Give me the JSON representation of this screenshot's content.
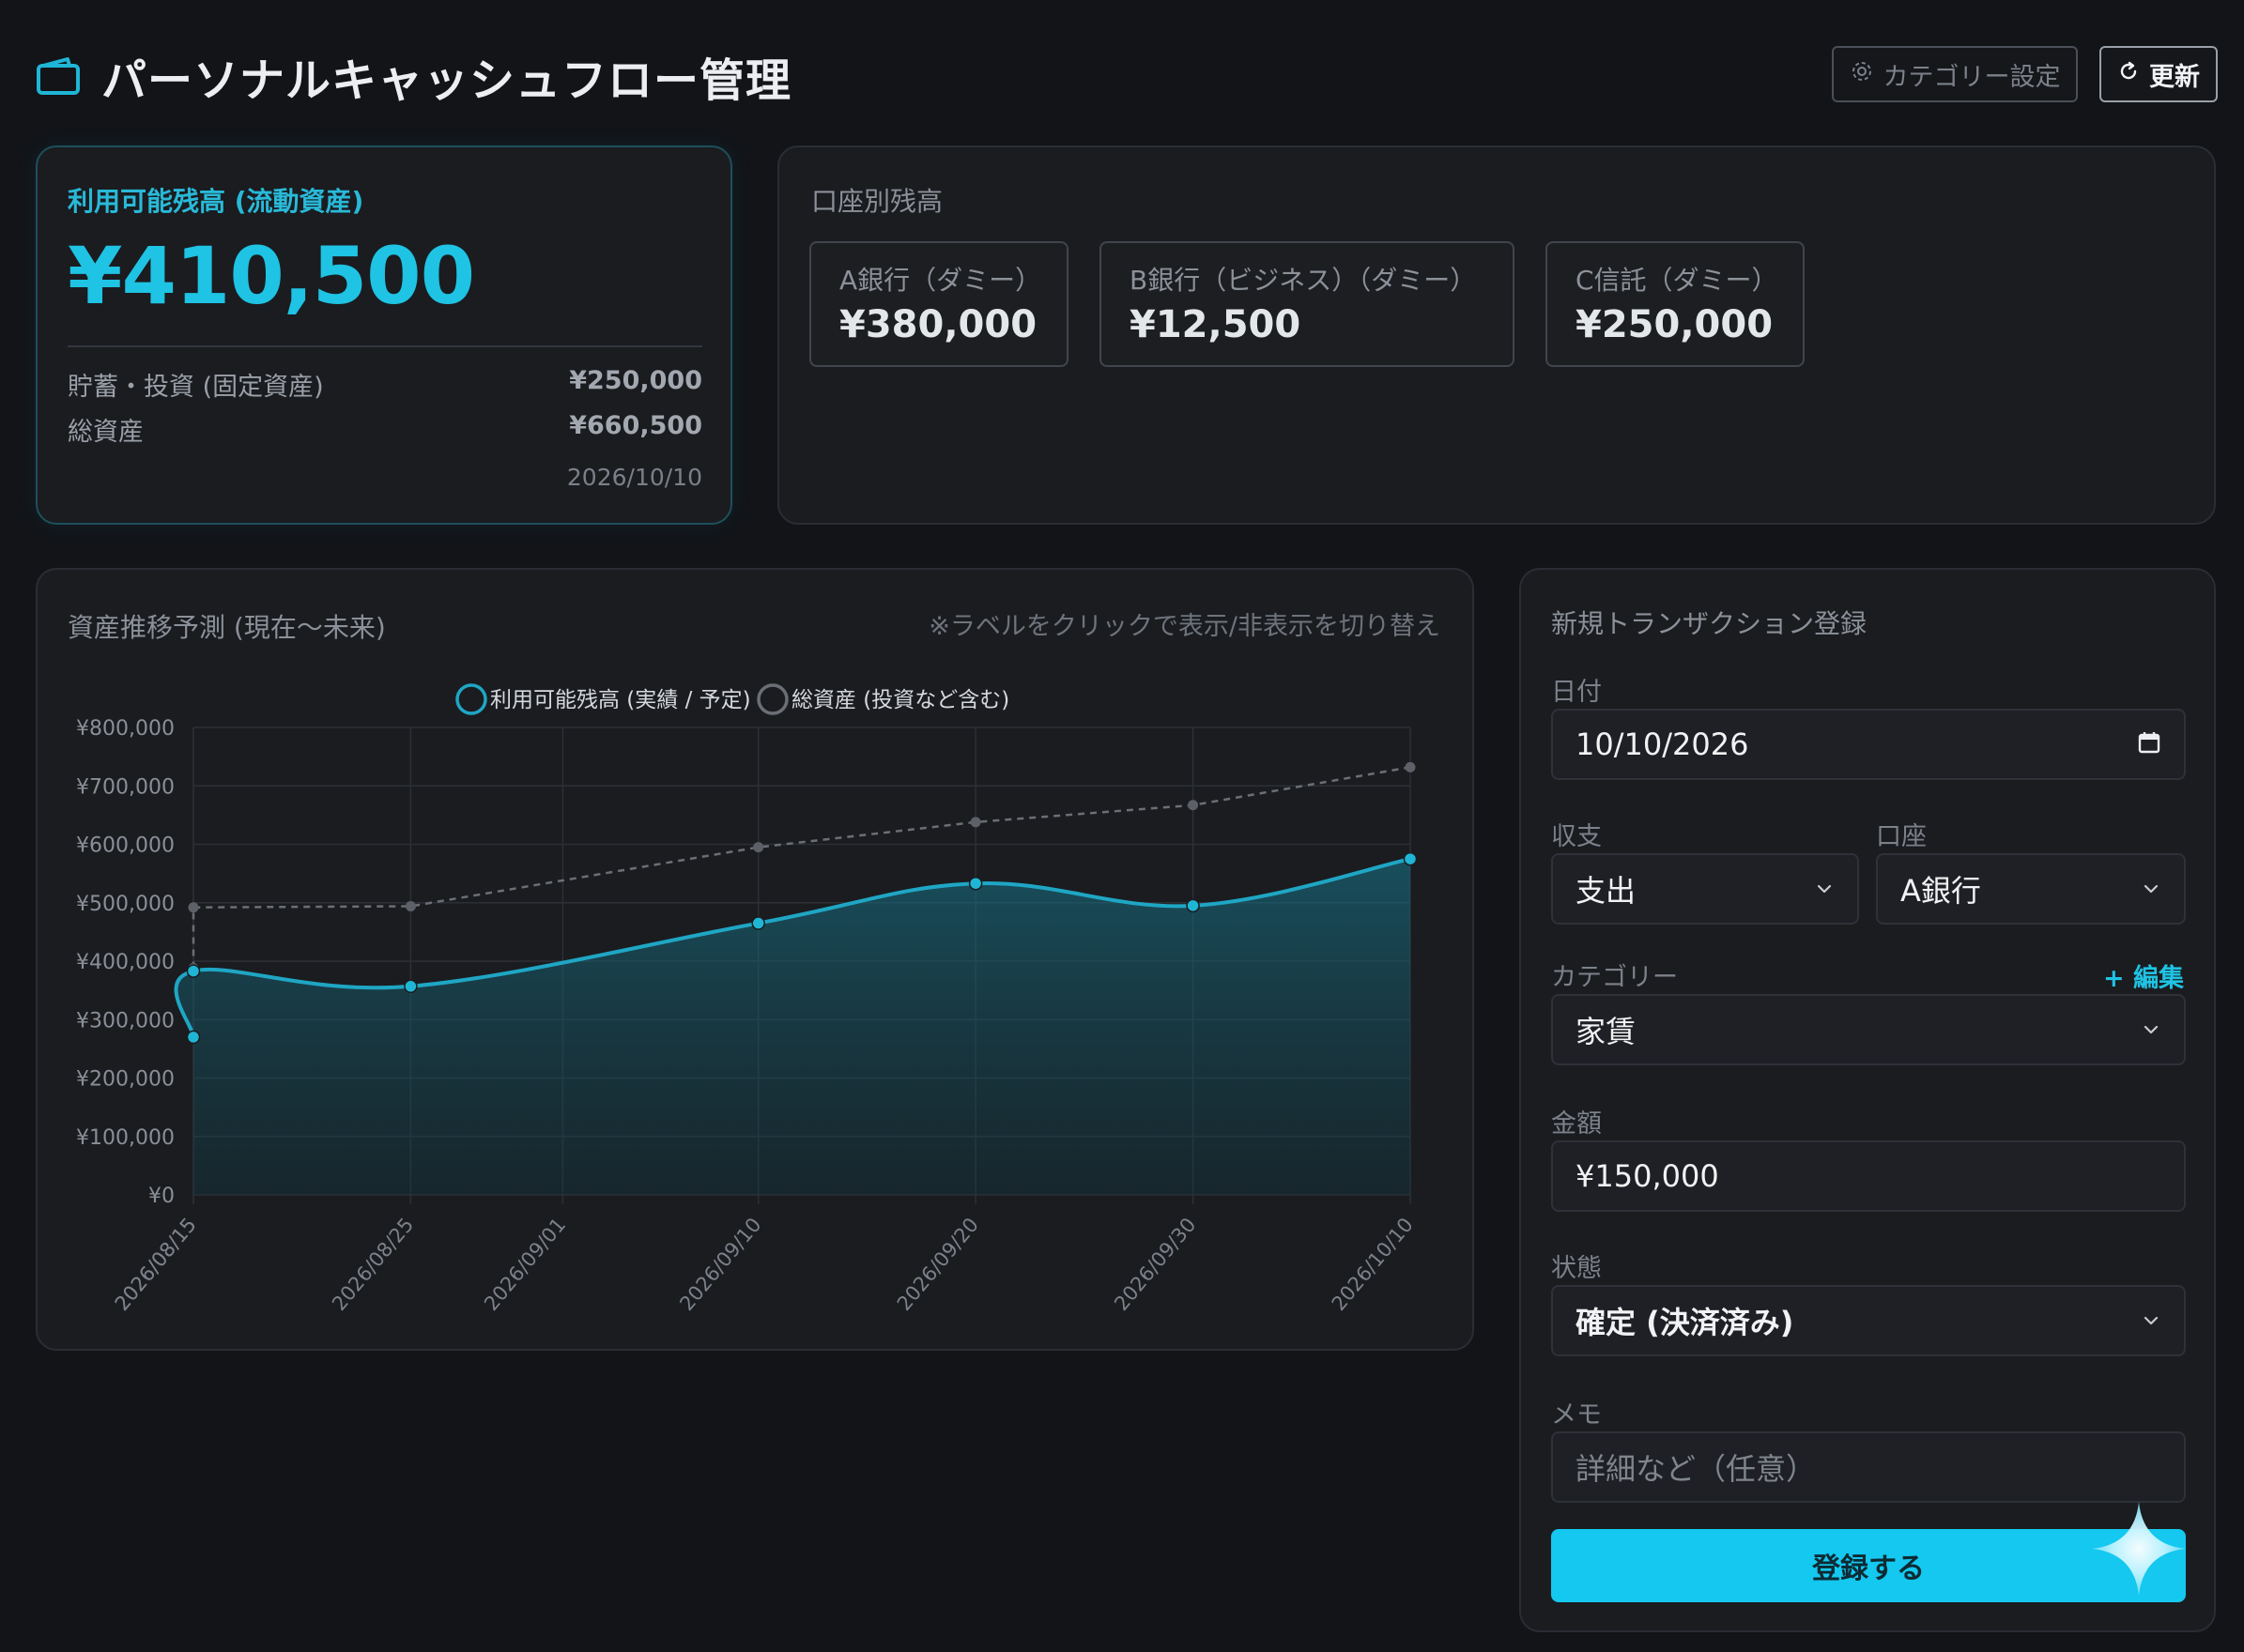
{
  "header": {
    "title": "パーソナルキャッシュフロー管理",
    "category_button": "カテゴリー設定",
    "refresh_button": "更新"
  },
  "summary": {
    "available_label": "利用可能残高 (流動資産)",
    "available_amount": "¥410,500",
    "savings_label": "貯蓄・投資 (固定資産)",
    "savings_amount": "¥250,000",
    "total_label": "総資産",
    "total_amount": "¥660,500",
    "date": "2026/10/10"
  },
  "accounts": {
    "label": "口座別残高",
    "items": [
      {
        "name": "A銀行（ダミー）",
        "amount": "¥380,000"
      },
      {
        "name": "B銀行（ビジネス）（ダミー）",
        "amount": "¥12,500"
      },
      {
        "name": "C信託（ダミー）",
        "amount": "¥250,000"
      }
    ]
  },
  "chart_panel": {
    "label": "資産推移予測 (現在〜未来)",
    "hint": "※ラベルをクリックで表示/非表示を切り替え"
  },
  "chart_data": {
    "type": "area",
    "x": [
      "2026/08/15",
      "2026/08/15",
      "2026/08/25",
      "2026/09/01",
      "2026/09/10",
      "2026/09/20",
      "2026/09/30",
      "2026/10/10"
    ],
    "x_day_offsets": [
      0,
      0,
      10,
      17,
      26,
      36,
      46,
      56
    ],
    "point_index": [
      0,
      1,
      2,
      4,
      5,
      6,
      7
    ],
    "ylim": [
      0,
      800000
    ],
    "yticks": [
      "¥800,000",
      "¥700,000",
      "¥600,000",
      "¥500,000",
      "¥400,000",
      "¥300,000",
      "¥200,000",
      "¥100,000",
      "¥0"
    ],
    "legend_position": "top-center",
    "grid": true,
    "series": [
      {
        "name": "利用可能残高 (実績 / 予定)",
        "style": "solid-filled",
        "color": "#1fa6c4",
        "points": [
          [
            0,
            270000
          ],
          [
            1,
            383000
          ],
          [
            2,
            357000
          ],
          [
            3,
            465000
          ],
          [
            4,
            533000
          ],
          [
            5,
            495000
          ],
          [
            6,
            575000
          ]
        ]
      },
      {
        "name": "総資産 (投資など含む)",
        "style": "dashed",
        "color": "#6b6f75",
        "points": [
          [
            0,
            388000
          ],
          [
            1,
            492000
          ],
          [
            2,
            494000
          ],
          [
            3,
            595000
          ],
          [
            4,
            638000
          ],
          [
            5,
            667000
          ],
          [
            6,
            732000
          ]
        ]
      }
    ]
  },
  "form": {
    "title": "新規トランザクション登録",
    "date_label": "日付",
    "date_value": "10/10/2026",
    "type_label": "収支",
    "type_value": "支出",
    "account_label": "口座",
    "account_value": "A銀行",
    "category_label": "カテゴリー",
    "category_edit": "+ 編集",
    "category_value": "家賃",
    "amount_label": "金額",
    "amount_value": "¥150,000",
    "status_label": "状態",
    "status_value": "確定 (決済済み)",
    "memo_label": "メモ",
    "memo_placeholder": "詳細など（任意）",
    "submit": "登録する"
  },
  "colors": {
    "accent": "#1fc3e3",
    "background": "#121418",
    "card": "#1a1c20",
    "submit": "#14c8ef"
  }
}
